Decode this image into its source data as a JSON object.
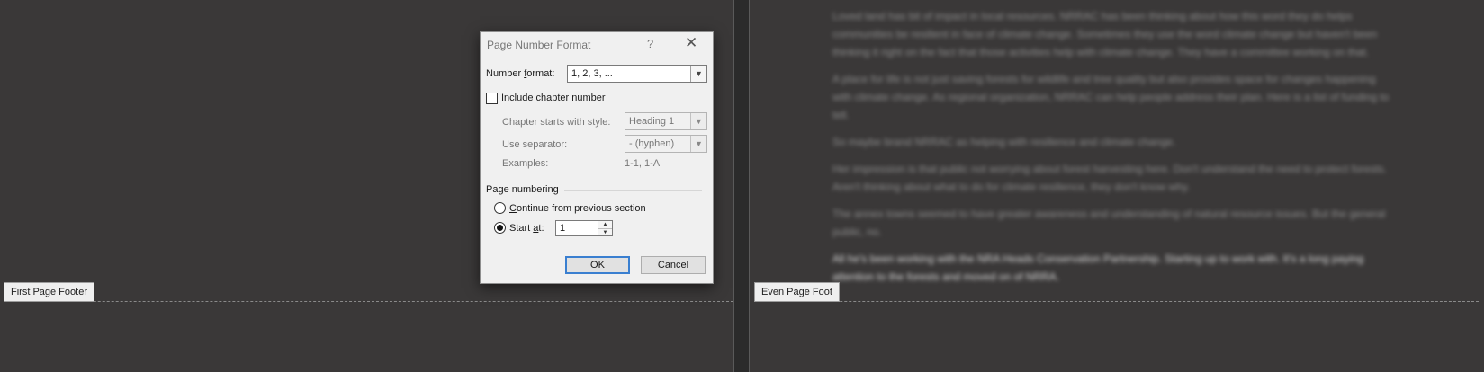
{
  "left_footer": {
    "label": "First Page Footer"
  },
  "right_footer": {
    "label": "Even Page Foot"
  },
  "background_text": {
    "paragraphs": [
      "Loved land has bit of impact in local resources. NRRAC has been thinking about how this word they do helps communities be resilient in face of climate change. Sometimes they use the word climate change but haven't been thinking it right on the fact that those activities help with climate change. They have a committee working on that.",
      "A place for life is not just saving forests for wildlife and tree quality but also provides space for changes happening with climate change. As regional organization, NRRAC can help people address their plan. Here is a list of funding to tell.",
      "So maybe brand NRRAC as helping with resilience and climate change.",
      "Her impression is that public not worrying about forest harvesting here. Don't understand the need to protect forests. Aren't thinking about what to do for climate resilience, they don't know why.",
      "The annex towns seemed to have greater awareness and understanding of natural resource issues. But the general public, no.",
      "All he's been working with the NRA Heads Conservation Partnership. Starting up to work with. It's a long paying attention to the forests and moved on of NRRA."
    ]
  },
  "dialog": {
    "title": "Page Number Format",
    "help_glyph": "?",
    "close_glyph": "✕",
    "number_format": {
      "label_pre": "Number ",
      "label_key": "f",
      "label_post": "ormat:",
      "value": "1, 2, 3, ..."
    },
    "include_chapter": {
      "label_pre": "Include chapter ",
      "label_key": "n",
      "label_post": "umber",
      "checked": false
    },
    "chapter_style": {
      "label": "Chapter starts with style:",
      "value": "Heading 1"
    },
    "separator": {
      "label": "Use separator:",
      "value": "-   (hyphen)"
    },
    "examples": {
      "label": "Examples:",
      "value": "1-1, 1-A"
    },
    "page_numbering": {
      "heading": "Page numbering",
      "continue": {
        "label_key": "C",
        "label_post": "ontinue from previous section",
        "selected": false
      },
      "start_at": {
        "label_pre": "Start ",
        "label_key": "a",
        "label_post": "t:",
        "selected": true,
        "value": "1"
      }
    },
    "ok_label": "OK",
    "cancel_label": "Cancel"
  },
  "colors": {
    "workspace": "#3a3838",
    "dialog_bg": "#f0f0f0",
    "default_button_border": "#3a7fd0"
  },
  "icons": {
    "dropdown": "chevron-down-icon",
    "spin_up": "triangle-up-icon",
    "spin_down": "triangle-down-icon"
  }
}
